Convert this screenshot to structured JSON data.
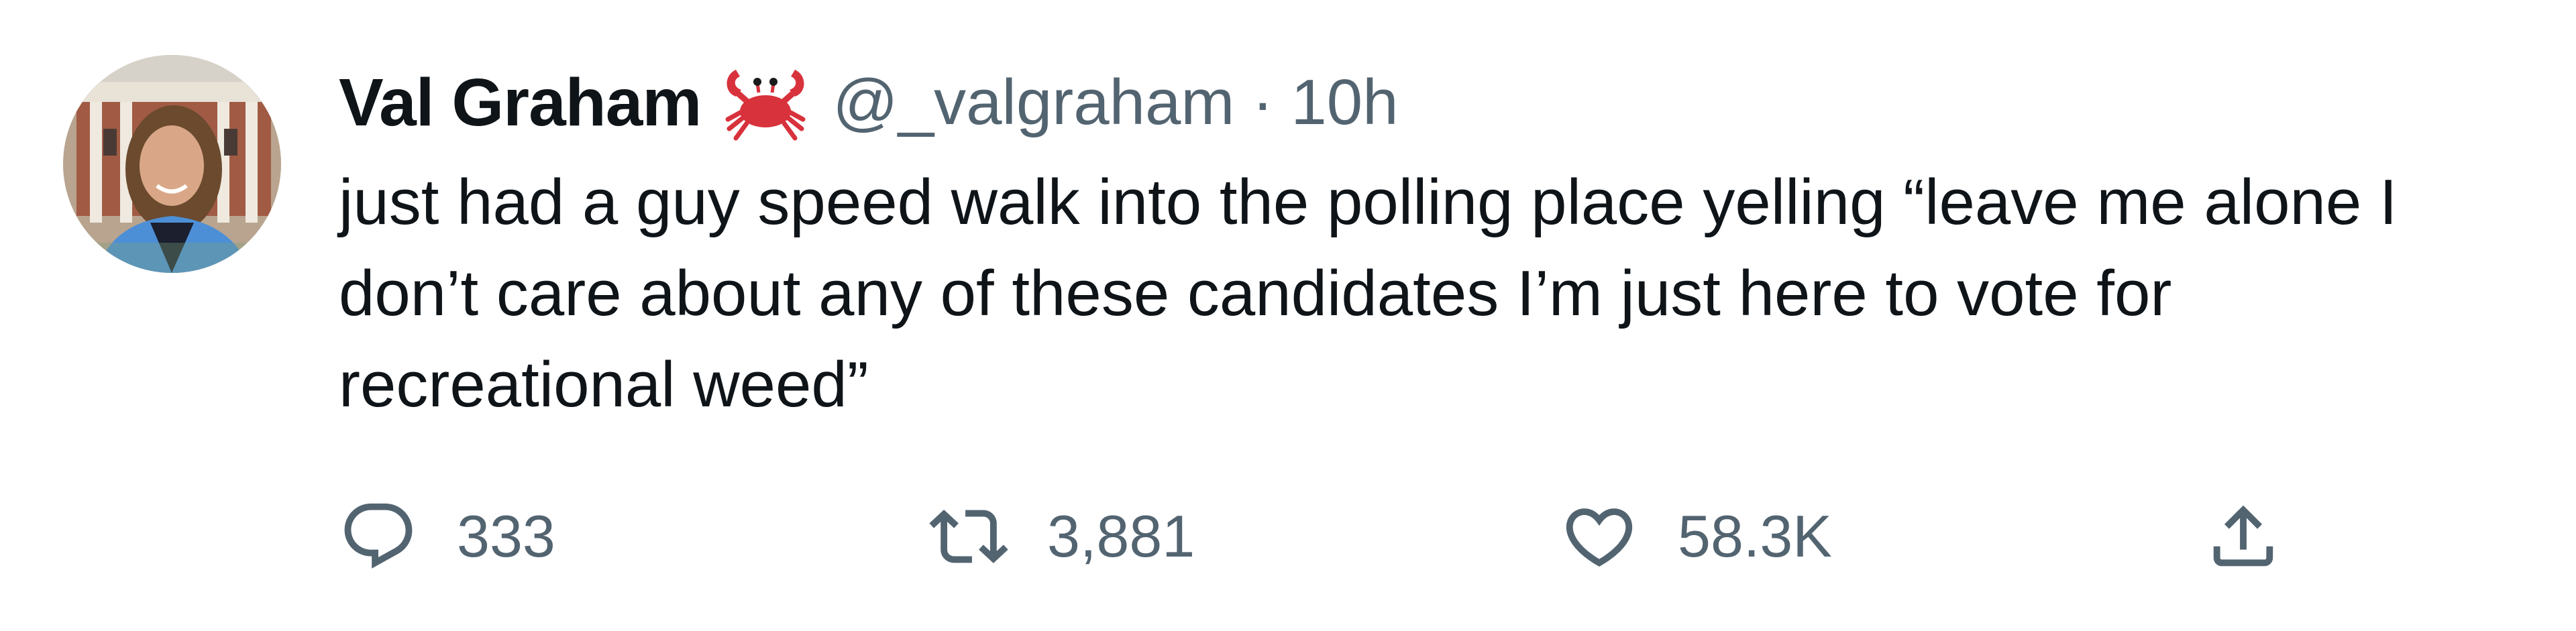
{
  "tweet": {
    "author": {
      "name": "Val Graham",
      "emoji": "crab-emoji",
      "handle": "@_valgraham",
      "separator": "·",
      "time": "10h"
    },
    "text": "just had a guy speed walk into the polling place yelling “leave me alone I\ndon’t care about any of these candidates I’m just here to vote for\nrecreational weed”",
    "actions": {
      "replies": "333",
      "retweets": "3,881",
      "likes": "58.3K"
    }
  },
  "colors": {
    "text_primary": "#0f1419",
    "text_secondary": "#536471",
    "crab": "#d8323c"
  },
  "icons": [
    "reply-icon",
    "retweet-icon",
    "like-icon",
    "share-icon"
  ]
}
